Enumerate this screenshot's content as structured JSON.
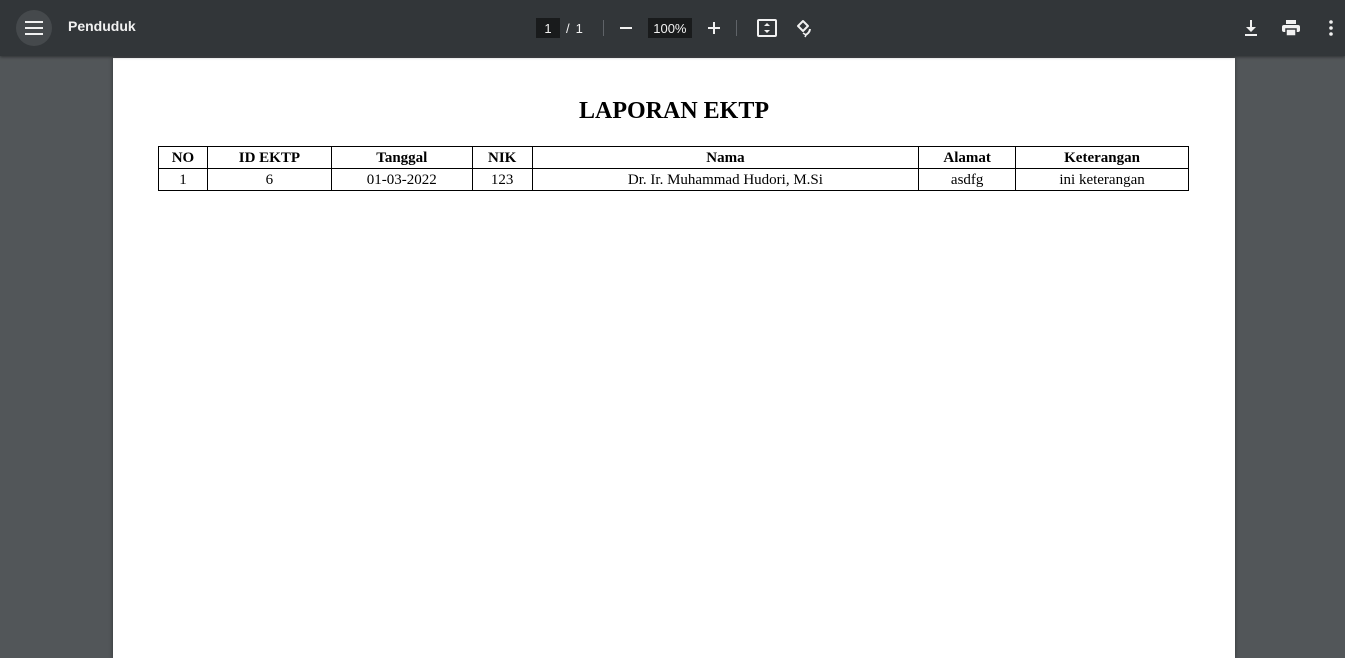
{
  "toolbar": {
    "menu_icon": "hamburger-menu-icon",
    "title": "Penduduk",
    "current_page": "1",
    "page_separator": "/",
    "total_pages": "1",
    "zoom": "100%",
    "icons": {
      "zoom_out": "minus-icon",
      "zoom_in": "plus-icon",
      "fit_page": "fit-to-page-icon",
      "rotate": "rotate-counterclockwise-icon",
      "download": "download-icon",
      "print": "print-icon",
      "more": "more-vertical-icon"
    }
  },
  "document": {
    "title": "LAPORAN EKTP",
    "table": {
      "headers": [
        "NO",
        "ID EKTP",
        "Tanggal",
        "NIK",
        "Nama",
        "Alamat",
        "Keterangan"
      ],
      "rows": [
        [
          "1",
          "6",
          "01-03-2022",
          "123",
          "Dr. Ir. Muhammad Hudori, M.Si",
          "asdfg",
          "ini keterangan"
        ]
      ]
    }
  },
  "colors": {
    "toolbar_bg": "#323639",
    "viewer_bg": "#525659",
    "page_bg": "#ffffff",
    "input_bg": "#191b1c",
    "text_light": "#f1f1f1"
  }
}
